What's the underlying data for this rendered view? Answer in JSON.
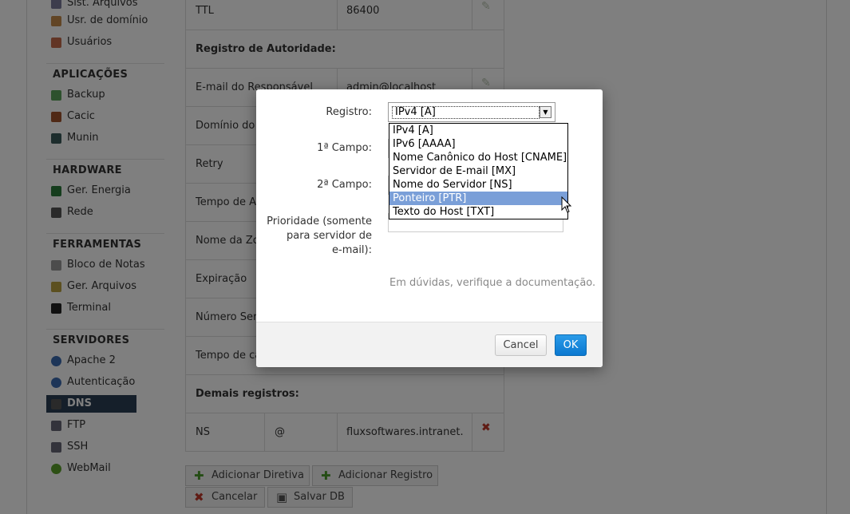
{
  "sidebar": {
    "items_top": [
      "Sist. Arquivos",
      "Usr. de domínio",
      "Usuários"
    ],
    "sections": [
      {
        "title": "APLICAÇÕES",
        "items": [
          "Backup",
          "Cacic",
          "Munin"
        ]
      },
      {
        "title": "HARDWARE",
        "items": [
          "Ger. Energia",
          "Rede"
        ]
      },
      {
        "title": "FERRAMENTAS",
        "items": [
          "Bloco de Notas",
          "Ger. Arquivos",
          "Terminal"
        ]
      },
      {
        "title": "SERVIDORES",
        "items": [
          "Apache 2",
          "Autenticação",
          "DNS",
          "FTP",
          "SSH",
          "WebMail"
        ]
      }
    ],
    "active_item": "DNS"
  },
  "table": {
    "ttl_label": "TTL",
    "ttl_value": "86400",
    "soa_header": "Registro de Autoridade:",
    "rows": [
      {
        "label": "E-mail do Responsável",
        "value": "admin@localhost"
      },
      {
        "label": "Domínio do s",
        "value": ""
      },
      {
        "label": "Retry",
        "value": ""
      },
      {
        "label": "Tempo de At",
        "value": ""
      },
      {
        "label": "Nome da Zo",
        "value": ""
      },
      {
        "label": "Expiração",
        "value": ""
      },
      {
        "label": "Número Seri",
        "value": ""
      },
      {
        "label": "Tempo de ca",
        "value": ""
      }
    ],
    "other_header": "Demais registros:",
    "ns_row": {
      "type": "NS",
      "name": "@",
      "value": "fluxsoftwares.intranet."
    }
  },
  "buttons": {
    "add_directive": "Adicionar Diretiva",
    "add_record": "Adicionar Registro",
    "cancel": "Cancelar",
    "save_db": "Salvar DB"
  },
  "dialog": {
    "record_label": "Registro:",
    "record_selected": "IPv4 [A]",
    "options": [
      "IPv4 [A]",
      "IPv6 [AAAA]",
      "Nome Canônico do Host [CNAME]",
      "Servidor de E-mail [MX]",
      "Nome do Servidor [NS]",
      "Ponteiro [PTR]",
      "Texto do Host [TXT]"
    ],
    "highlighted_option": "Ponteiro [PTR]",
    "field1_label": "1ª Campo:",
    "field2_label": "2ª Campo:",
    "priority_label_1": "Prioridade (somente",
    "priority_label_2": "para servidor de",
    "priority_label_3": "e-mail):",
    "hint": "Em dúvidas, verifique a documentação.",
    "cancel_label": "Cancel",
    "ok_label": "OK"
  },
  "colors": {
    "active_sidebar": "#2b3f54",
    "ok_button": "#0b78d0",
    "highlight_option": "#7a9fd8"
  }
}
